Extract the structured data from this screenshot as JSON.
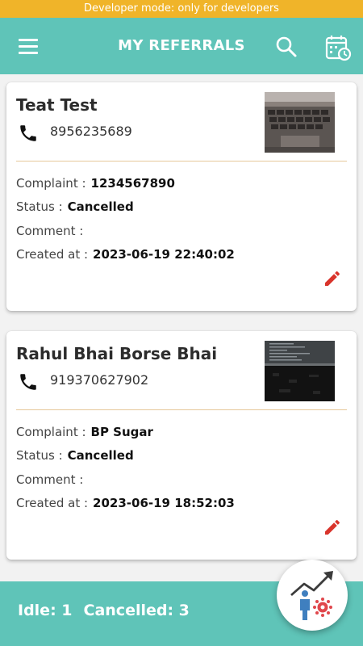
{
  "dev_banner": "Developer mode: only for developers",
  "header": {
    "title": "MY REFERRALS"
  },
  "labels": {
    "complaint": "Complaint :",
    "status": "Status :",
    "comment": "Comment :",
    "created_at": "Created at :"
  },
  "referrals": [
    {
      "name": "Teat Test",
      "phone": "8956235689",
      "complaint": "1234567890",
      "status": "Cancelled",
      "comment": "",
      "created_at": "2023-06-19 22:40:02"
    },
    {
      "name": "Rahul Bhai Borse Bhai",
      "phone": "919370627902",
      "complaint": "BP Sugar",
      "status": "Cancelled",
      "comment": "",
      "created_at": "2023-06-19 18:52:03"
    }
  ],
  "footer": {
    "idle": "Idle: 1",
    "cancelled": "Cancelled: 3"
  },
  "icons": {
    "menu": "menu-icon",
    "search": "search-icon",
    "calendar": "calendar-clock-icon",
    "phone": "phone-icon",
    "edit": "pencil-icon",
    "fab": "growth-chart-person-icon"
  },
  "colors": {
    "primary": "#5fc4b8",
    "dev_banner": "#f0b429",
    "edit": "#d9342b",
    "divider": "#e6c89a"
  }
}
